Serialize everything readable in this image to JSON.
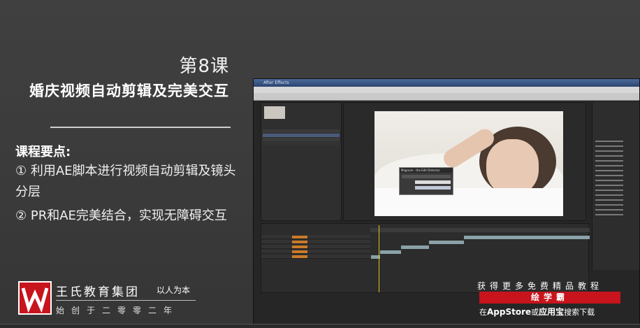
{
  "lesson": {
    "number": "第8课",
    "title": "婚庆视频自动剪辑及完美交互"
  },
  "points": {
    "heading": "课程要点:",
    "items": [
      "① 利用AE脚本进行视频自动剪辑及镜头分层",
      "② PR和AE完美结合，实现无障碍交互"
    ]
  },
  "brand": {
    "name": "王氏教育集团",
    "motto": "以人为本",
    "founded": "始创于二零零二年",
    "color": "#c8141c"
  },
  "promo": {
    "line1": "获得更多免费精品教程",
    "site": "绘学霸",
    "line2_prefix": "在",
    "store1": "AppStore",
    "or": "或",
    "store2": "应用宝",
    "line2_suffix": "搜索下载"
  },
  "screenshot": {
    "app": "After Effects",
    "dialog": "Magnum - the Edit Detector"
  }
}
